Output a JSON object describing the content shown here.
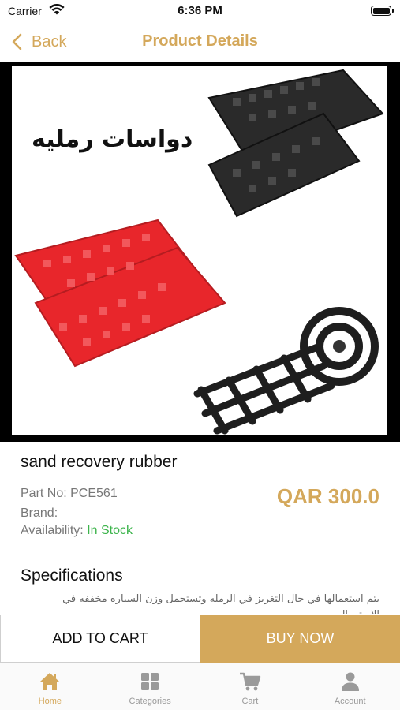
{
  "status_bar": {
    "carrier": "Carrier",
    "time": "6:36 PM"
  },
  "nav": {
    "back_label": "Back",
    "title": "Product Details"
  },
  "image": {
    "overlay_text": "دواسات رمليه",
    "colors": {
      "black_mat": "#2a2a2a",
      "red_mat": "#e8262b"
    }
  },
  "product": {
    "name": "sand recovery rubber",
    "part_no": "Part No: PCE561",
    "brand": "Brand:",
    "availability_label": "Availability:",
    "availability_value": "In Stock",
    "price": "QAR 300.0"
  },
  "specifications": {
    "title": "Specifications",
    "text": "يتم استعمالها في حال التغريز في الرمله وتستحمل وزن السياره مخففه في الاستعمال"
  },
  "actions": {
    "add_to_cart": "ADD TO CART",
    "buy_now": "BUY NOW"
  },
  "tabs": [
    {
      "label": "Home",
      "icon": "home-icon",
      "active": true
    },
    {
      "label": "Categories",
      "icon": "grid-icon",
      "active": false
    },
    {
      "label": "Cart",
      "icon": "cart-icon",
      "active": false
    },
    {
      "label": "Account",
      "icon": "person-icon",
      "active": false
    }
  ],
  "theme": {
    "accent": "#D4A85B",
    "in_stock": "#3CB44B"
  }
}
